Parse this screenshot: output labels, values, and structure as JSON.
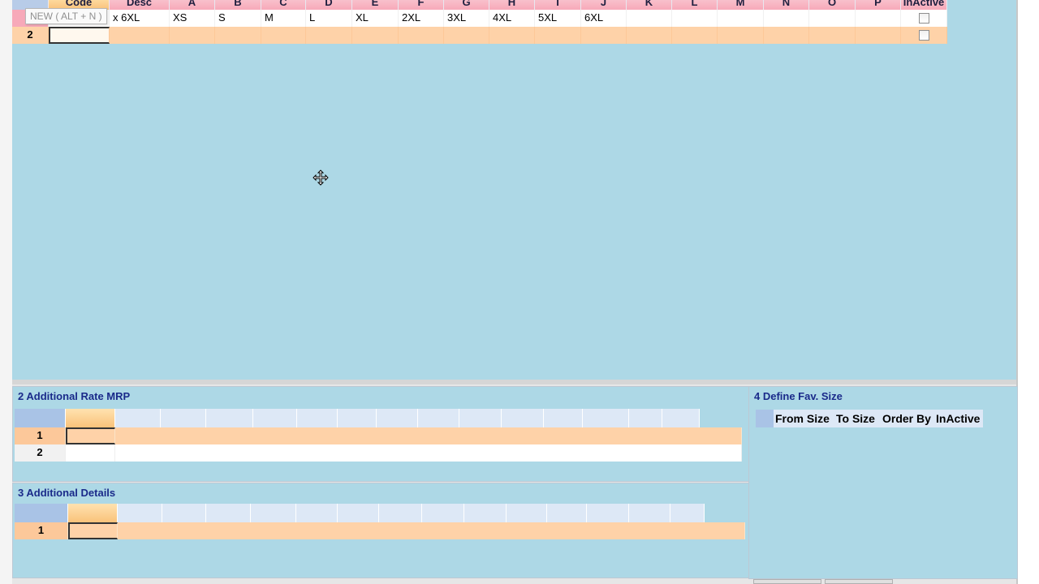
{
  "top_grid": {
    "columns": [
      "Code",
      "Desc",
      "A",
      "B",
      "C",
      "D",
      "E",
      "F",
      "G",
      "H",
      "I",
      "J",
      "K",
      "L",
      "M",
      "N",
      "O",
      "P",
      "InActive"
    ],
    "rows": [
      {
        "row_no": "",
        "code": "",
        "desc": "x 6XL",
        "values": [
          "XS",
          "S",
          "M",
          "L",
          "XL",
          "2XL",
          "3XL",
          "4XL",
          "5XL",
          "6XL",
          "",
          "",
          "",
          "",
          "",
          ""
        ],
        "inactive": false
      },
      {
        "row_no": "2",
        "code": "",
        "desc": "",
        "values": [
          "",
          "",
          "",
          "",
          "",
          "",
          "",
          "",
          "",
          "",
          "",
          "",
          "",
          "",
          "",
          ""
        ],
        "inactive": false
      }
    ]
  },
  "tooltip": {
    "text": "NEW ( ALT + N )"
  },
  "panels": {
    "rate_mrp": {
      "title": "2 Additional Rate MRP",
      "rows": [
        "1",
        "2"
      ]
    },
    "details": {
      "title": "3 Additional Details",
      "rows": [
        "1"
      ]
    },
    "fav_size": {
      "title": "4 Define Fav. Size",
      "columns": [
        "From Size",
        "To Size",
        "Order By",
        "InActive"
      ]
    }
  },
  "colors": {
    "background": "#add8e6",
    "header_pink": "#f7a9b9",
    "row_peach": "#fed2a8",
    "panel_title": "#1a2a8a"
  },
  "icons": {
    "cursor": "move-cursor-icon"
  }
}
